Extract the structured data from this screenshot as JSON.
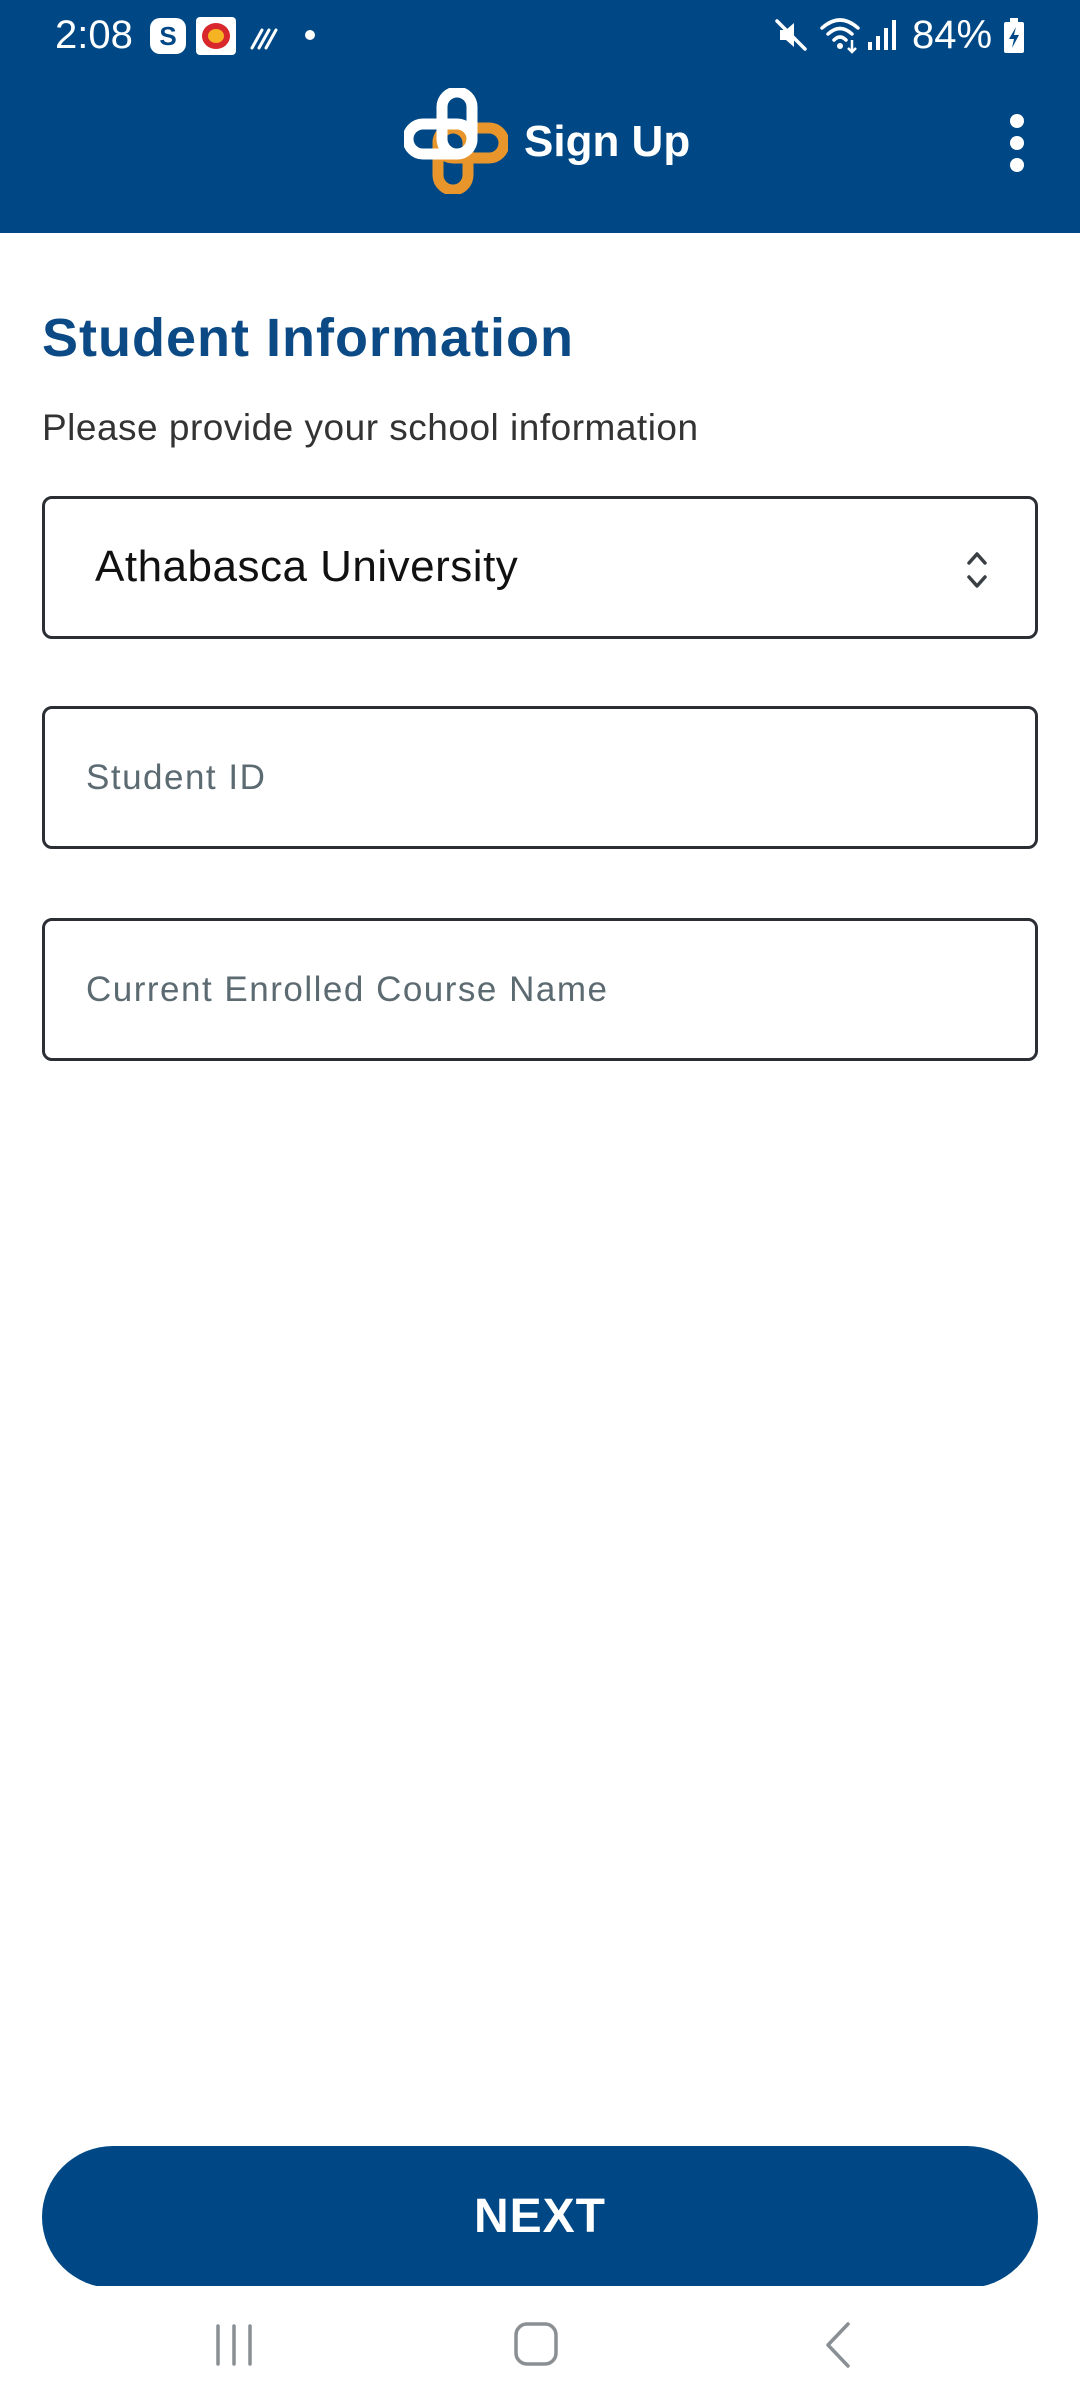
{
  "status_bar": {
    "time": "2:08",
    "app_s_letter": "S",
    "battery": "84%"
  },
  "app_bar": {
    "title": "Sign Up",
    "logo_icon": "medical-cross-logo-icon",
    "menu_icon": "more-vertical-icon"
  },
  "form": {
    "title": "Student Information",
    "subtitle": "Please provide your school information",
    "school_select": {
      "value": "Athabasca University",
      "icon": "chevron-up-down-icon"
    },
    "student_id": {
      "placeholder": "Student ID",
      "value": ""
    },
    "course_name": {
      "placeholder": "Current Enrolled Course Name",
      "value": ""
    },
    "next_label": "NEXT"
  },
  "nav_bar": {
    "icons": [
      "recents-icon",
      "home-icon",
      "back-icon"
    ]
  },
  "colors": {
    "primary": "#004885",
    "accent": "#E8962C",
    "title_text": "#0B4A85",
    "placeholder": "#5C6A72"
  }
}
